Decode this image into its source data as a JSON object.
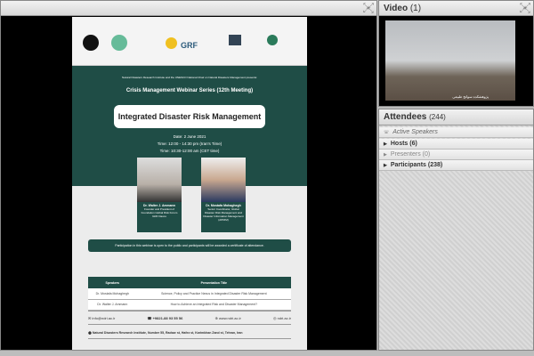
{
  "share": {
    "fullscreen_icon": "fullscreen-icon"
  },
  "poster": {
    "grf": "GRF",
    "presents": "Natural Disasters Research Institute and the UNESCO National Chair on Natural Disasters Management presents:",
    "series": "Crisis Management Webinar Series (12th Meeting)",
    "title": "Integrated Disaster Risk Management",
    "date": "Date: 2 June 2021",
    "time_iran": "Time: 12:00 - 14:30 pm (Iran's Time)",
    "time_cet": "Time: 10:30-12:00 am (CET time)",
    "speakers": [
      {
        "name": "Dr. Walter J. Ammann",
        "desc": "Founder and President of Foundation Global Risk Forum GRF Davos"
      },
      {
        "name": "Dr. Mostafa Mohaghegh",
        "desc": "Senior Coordinator, Global Disaster Risk Management and Disaster Information Management (APDIM)"
      }
    ],
    "note": "Participation in this webinar is open to the public and participants will be awarded a certificate of attendance.",
    "table": {
      "headers": [
        "Speakers",
        "Presentation Title"
      ],
      "rows": [
        [
          "Dr. Mostafa Mohaghegh",
          "Science, Policy and Practice Nexus in Integrated Disaster Risk Management"
        ],
        [
          "Dr. Walter J. Ammann",
          "How to Achieve an Integrated Risk and Disaster Management?"
        ]
      ]
    },
    "email": "info@ndri.ac.ir",
    "phone": "+9821-88 93 55 56",
    "web": "www.ndri.ac.ir",
    "insta": "ndri.ac.ir",
    "address": "Natural Disasters Research Institute, Number 55, Radsar st, Hafez st, Karimkhan Zand st, Tehran, Iran"
  },
  "video": {
    "title": "Video",
    "count": "(1)",
    "caption": "پژوهشکده سوانح طبیعی"
  },
  "attendees": {
    "title": "Attendees",
    "count": "(244)",
    "active": "Active Speakers",
    "hosts": "Hosts (6)",
    "presenters": "Presenters (0)",
    "participants": "Participants (238)"
  }
}
